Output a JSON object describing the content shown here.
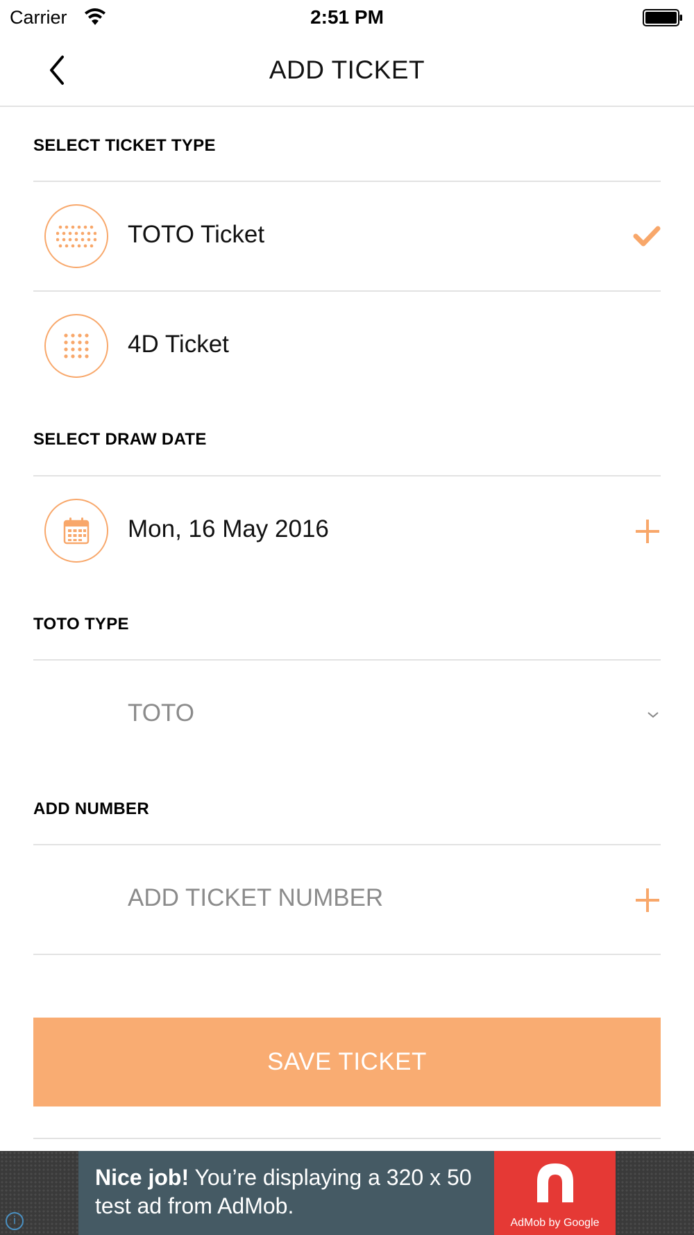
{
  "status_bar": {
    "carrier": "Carrier",
    "time": "2:51 PM"
  },
  "nav": {
    "title": "ADD TICKET",
    "back_icon": "chevron-left-icon"
  },
  "ticket_type": {
    "label": "SELECT TICKET TYPE",
    "options": [
      {
        "label": "TOTO Ticket",
        "icon": "toto-balls-icon",
        "selected": true
      },
      {
        "label": "4D Ticket",
        "icon": "4d-grid-icon",
        "selected": false
      }
    ]
  },
  "draw_date": {
    "label": "SELECT DRAW DATE",
    "value": "Mon, 16 May 2016",
    "icon": "calendar-icon"
  },
  "toto_type": {
    "label": "TOTO TYPE",
    "value": "TOTO"
  },
  "add_number": {
    "label": "ADD NUMBER",
    "placeholder": "ADD TICKET NUMBER"
  },
  "save_button": {
    "label": "SAVE TICKET"
  },
  "ad": {
    "headline": "Nice job!",
    "body": "You’re displaying a 320 x 50 test ad from AdMob.",
    "brand": "AdMob by Google",
    "info": "i"
  },
  "colors": {
    "accent": "#f8a76a",
    "button": "#f9ac72",
    "divider": "#e2e2e2",
    "ad_bg": "#455a64",
    "ad_logo": "#e53935"
  }
}
